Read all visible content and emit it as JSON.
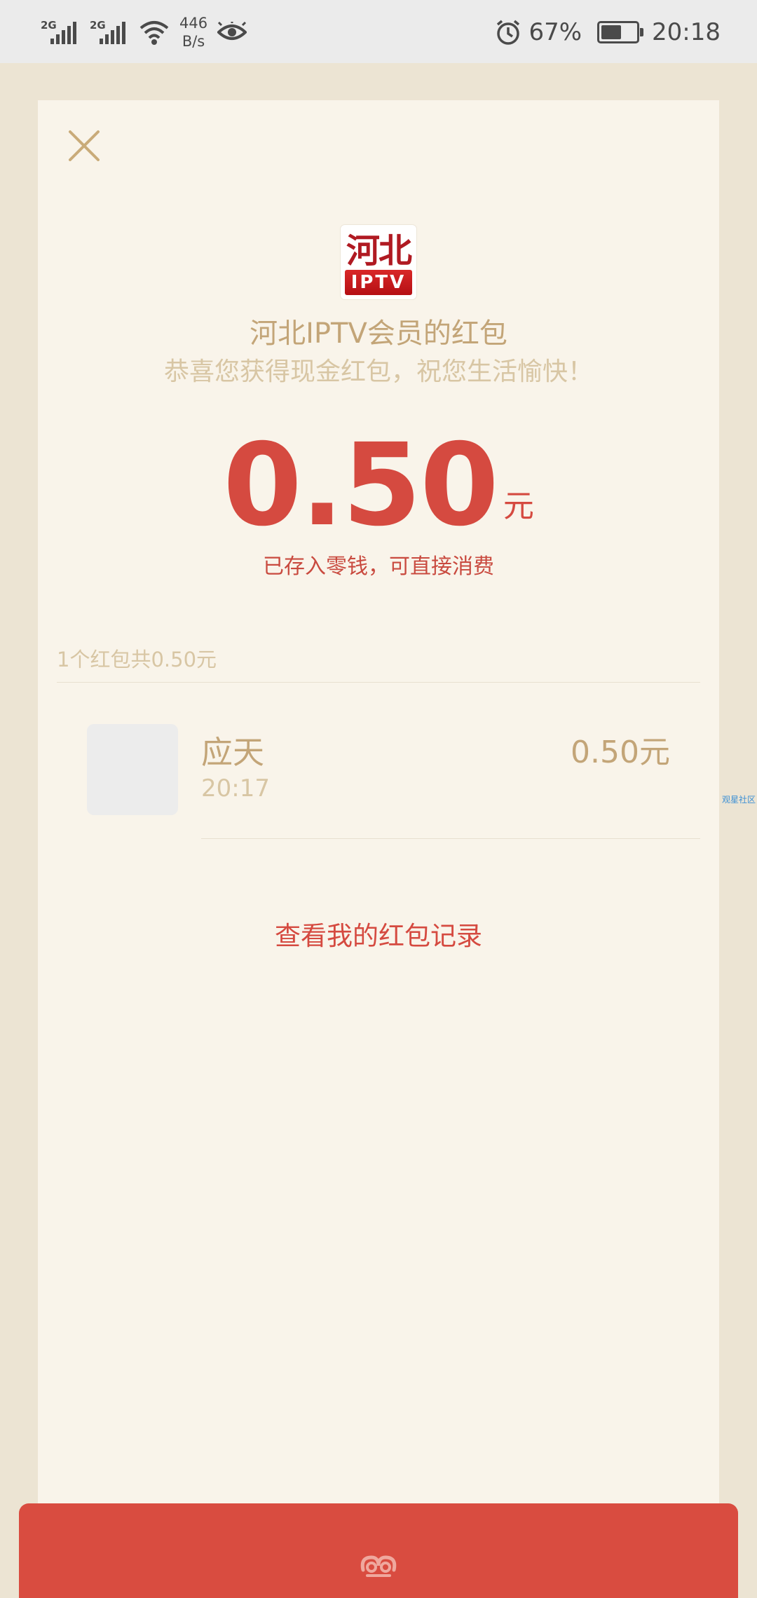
{
  "status_bar": {
    "signal1_label": "2G",
    "signal2_label": "2G",
    "net_speed_value": "446",
    "net_speed_unit": "B/s",
    "battery_percent": "67%",
    "battery_level": 0.67,
    "time": "20:18",
    "icons": [
      "signal-icon",
      "signal-icon",
      "wifi-icon",
      "eye-icon",
      "alarm-icon",
      "battery-icon"
    ]
  },
  "envelope": {
    "logo_top_text": "河北",
    "logo_bottom_text": "IPTV",
    "title": "河北IPTV会员的红包",
    "subtitle": "恭喜您获得现金红包，祝您生活愉快！",
    "amount": "0.50",
    "amount_unit": "元",
    "deposited_note": "已存入零钱，可直接消费",
    "summary": "1个红包共0.50元",
    "recipients": [
      {
        "name": "应天",
        "time": "20:17",
        "amount": "0.50元"
      }
    ],
    "record_link": "查看我的红包记录",
    "watermark": "观星社区"
  },
  "colors": {
    "accent_red": "#d54a40",
    "gold_text": "#c3a578",
    "light_gold_text": "#d8c6a4",
    "card_bg": "#f9f4ea",
    "page_bg": "#ece4d3"
  }
}
